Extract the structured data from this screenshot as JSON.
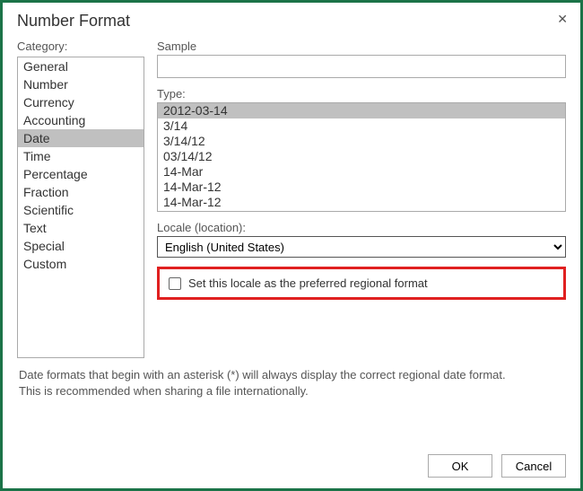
{
  "dialog": {
    "title": "Number Format",
    "close": "✕"
  },
  "category": {
    "label": "Category:",
    "items": [
      "General",
      "Number",
      "Currency",
      "Accounting",
      "Date",
      "Time",
      "Percentage",
      "Fraction",
      "Scientific",
      "Text",
      "Special",
      "Custom"
    ],
    "selected_index": 4
  },
  "sample": {
    "label": "Sample",
    "value": ""
  },
  "type": {
    "label": "Type:",
    "items": [
      "2012-03-14",
      "3/14",
      "3/14/12",
      "03/14/12",
      "14-Mar",
      "14-Mar-12",
      "14-Mar-12"
    ],
    "selected_index": 0
  },
  "locale": {
    "label": "Locale (location):",
    "value": "English (United States)"
  },
  "checkbox": {
    "label": "Set this locale as the preferred regional format",
    "checked": false
  },
  "help": {
    "line1": "Date formats that begin with an asterisk (*) will always display the correct regional date format.",
    "line2": "This is recommended when sharing a file internationally."
  },
  "buttons": {
    "ok": "OK",
    "cancel": "Cancel"
  }
}
